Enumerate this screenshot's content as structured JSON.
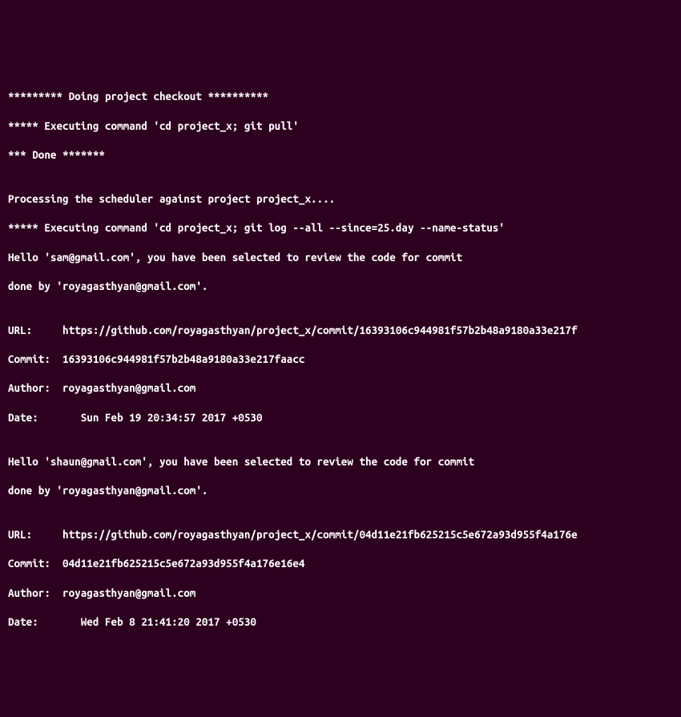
{
  "lines": [
    "********* Doing project checkout **********",
    "***** Executing command 'cd project_x; git pull'",
    "*** Done *******",
    "",
    "Processing the scheduler against project project_x....",
    "***** Executing command 'cd project_x; git log --all --since=25.day --name-status'",
    "Hello 'sam@gmail.com', you have been selected to review the code for commit",
    "done by 'royagasthyan@gmail.com'.",
    "",
    "URL:     https://github.com/royagasthyan/project_x/commit/16393106c944981f57b2b48a9180a33e217f",
    "Commit:  16393106c944981f57b2b48a9180a33e217faacc",
    "Author:  royagasthyan@gmail.com",
    "Date:       Sun Feb 19 20:34:57 2017 +0530",
    "",
    "Hello 'shaun@gmail.com', you have been selected to review the code for commit",
    "done by 'royagasthyan@gmail.com'.",
    "",
    "URL:     https://github.com/royagasthyan/project_x/commit/04d11e21fb625215c5e672a93d955f4a176e",
    "Commit:  04d11e21fb625215c5e672a93d955f4a176e16e4",
    "Author:  royagasthyan@gmail.com",
    "Date:       Wed Feb 8 21:41:20 2017 +0530"
  ]
}
